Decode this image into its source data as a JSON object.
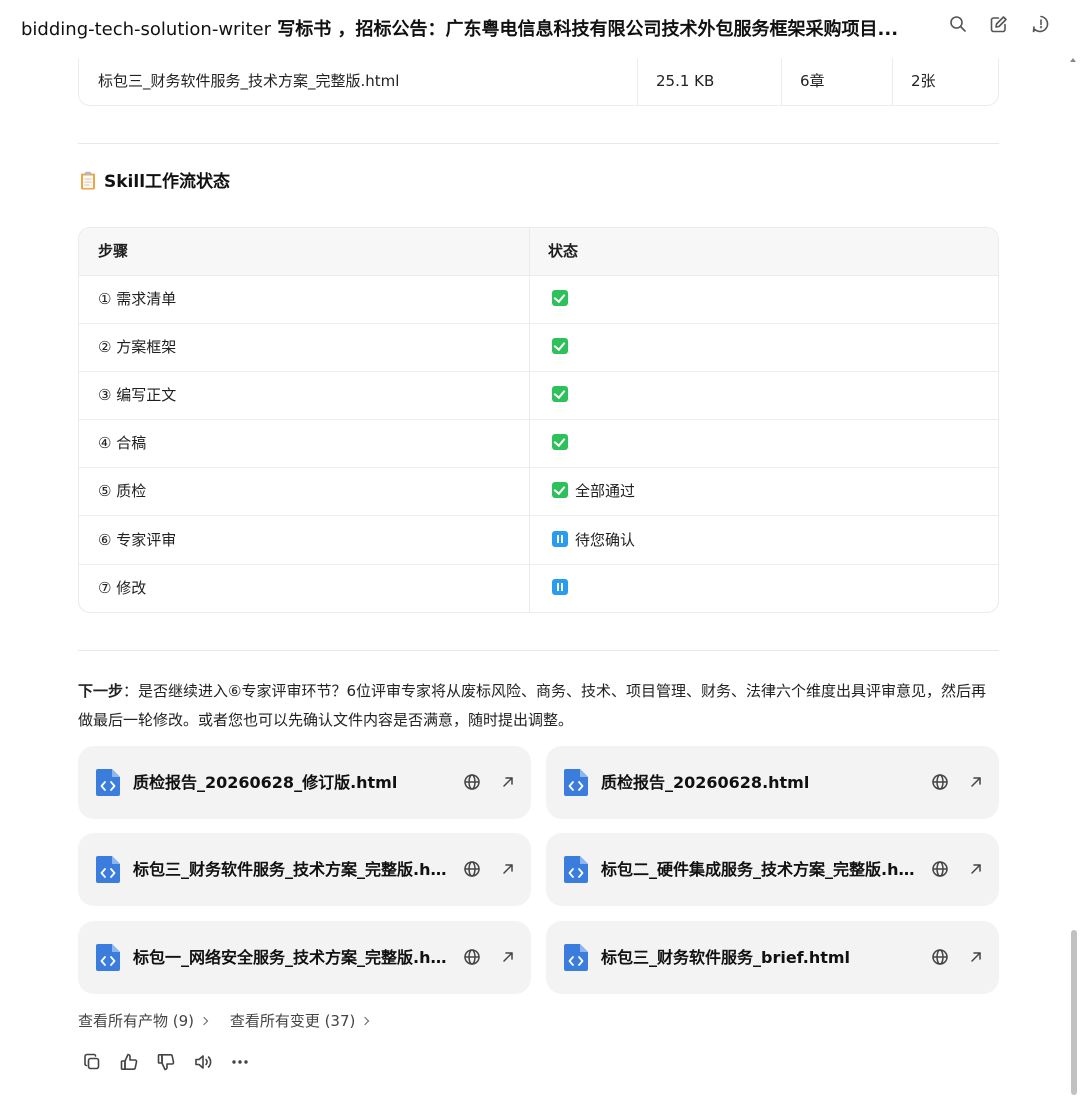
{
  "header": {
    "skill_name": "bidding-tech-solution-writer",
    "title_rest": " 写标书 ，招标公告：广东粤电信息科技有限公司技术外包服务框架采购项目...",
    "icons": [
      "search-icon",
      "new-chat-icon",
      "history-icon"
    ]
  },
  "file_table": {
    "last_row": [
      "标包三_财务软件服务_技术方案_完整版.html",
      "25.1 KB",
      "6章",
      "2张"
    ]
  },
  "workflow": {
    "title": "Skill工作流状态",
    "headers": [
      "步骤",
      "状态"
    ],
    "rows": [
      {
        "step": "① 需求清单",
        "icon": "check",
        "status": ""
      },
      {
        "step": "② 方案框架",
        "icon": "check",
        "status": ""
      },
      {
        "step": "③ 编写正文",
        "icon": "check",
        "status": ""
      },
      {
        "step": "④ 合稿",
        "icon": "check",
        "status": ""
      },
      {
        "step": "⑤ 质检",
        "icon": "check",
        "status": "全部通过"
      },
      {
        "step": "⑥ 专家评审",
        "icon": "pause",
        "status": "待您确认"
      },
      {
        "step": "⑦ 修改",
        "icon": "pause",
        "status": ""
      }
    ]
  },
  "next_step": {
    "label": "下一步",
    "text": "：是否继续进入⑥专家评审环节？6位评审专家将从废标风险、商务、技术、项目管理、财务、法律六个维度出具评审意见，然后再做最后一轮修改。或者您也可以先确认文件内容是否满意，随时提出调整。"
  },
  "artifacts": [
    {
      "name": "质检报告_20260628_修订版.html"
    },
    {
      "name": "质检报告_20260628.html"
    },
    {
      "name": "标包三_财务软件服务_技术方案_完整版.html"
    },
    {
      "name": "标包二_硬件集成服务_技术方案_完整版.html"
    },
    {
      "name": "标包一_网络安全服务_技术方案_完整版.html"
    },
    {
      "name": "标包三_财务软件服务_brief.html"
    }
  ],
  "links": {
    "all_artifacts": "查看所有产物 (9)",
    "all_changes": "查看所有变更 (37)"
  },
  "colors": {
    "check_green": "#2ec05a",
    "pause_blue": "#2a9cf0",
    "file_icon_blue": "#3b7ddd",
    "card_bg": "#f3f3f3"
  }
}
